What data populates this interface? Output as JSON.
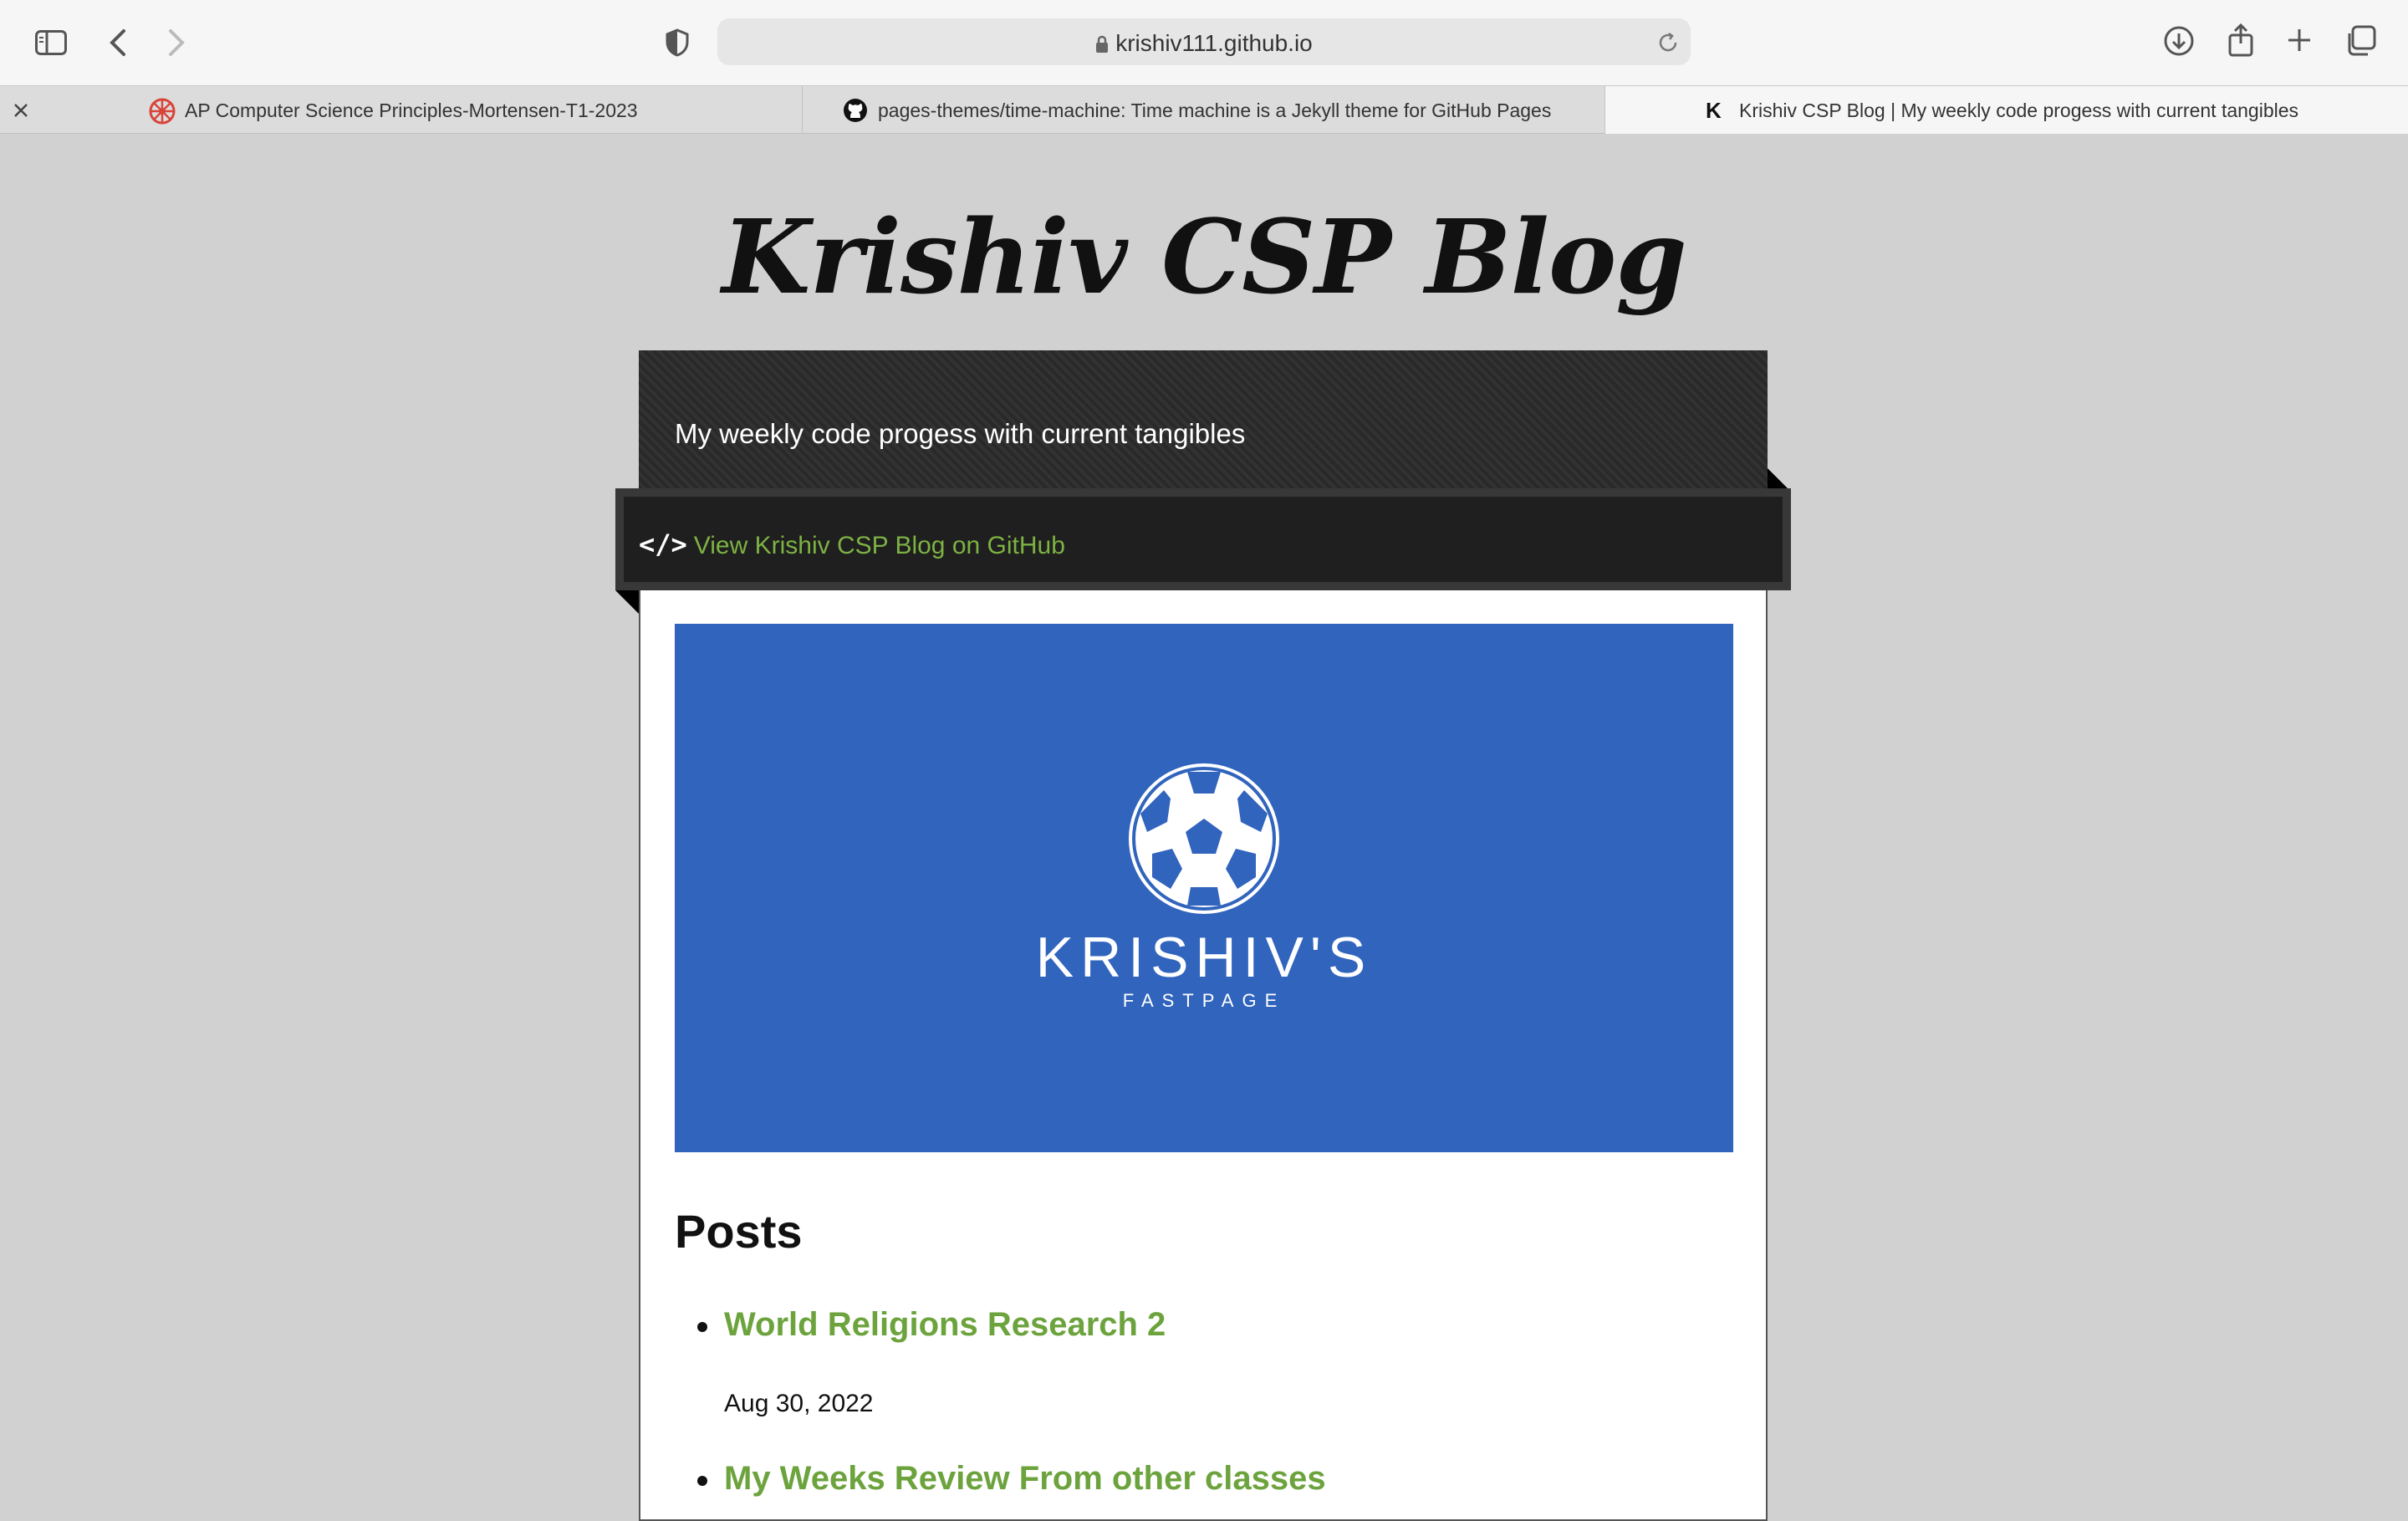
{
  "browser": {
    "url": "krishiv111.github.io",
    "tabs": [
      {
        "title": "AP Computer Science Principles-Mortensen-T1-2023",
        "active": false
      },
      {
        "title": "pages-themes/time-machine: Time machine is a Jekyll theme for GitHub Pages",
        "active": false
      },
      {
        "title": "Krishiv CSP Blog | My weekly code progess with current tangibles",
        "active": true
      }
    ]
  },
  "site": {
    "title": "Krishiv CSP Blog",
    "tagline": "My weekly code progess with current tangibles",
    "github_code_icon": "</>",
    "github_link": "View Krishiv CSP Blog on GitHub"
  },
  "banner": {
    "icon": "soccer-ball-icon",
    "brand": "KRISHIV'S",
    "subtitle": "FASTPAGE",
    "color": "#3164bd"
  },
  "posts": {
    "heading": "Posts",
    "items": [
      {
        "title": "World Religions Research 2",
        "date": "Aug 30, 2022"
      },
      {
        "title": "My Weeks Review From other classes",
        "date": ""
      }
    ]
  },
  "colors": {
    "link": "#6ca33d",
    "page_bg": "#d1d1d1",
    "header_bg": "#2b2b2b"
  }
}
